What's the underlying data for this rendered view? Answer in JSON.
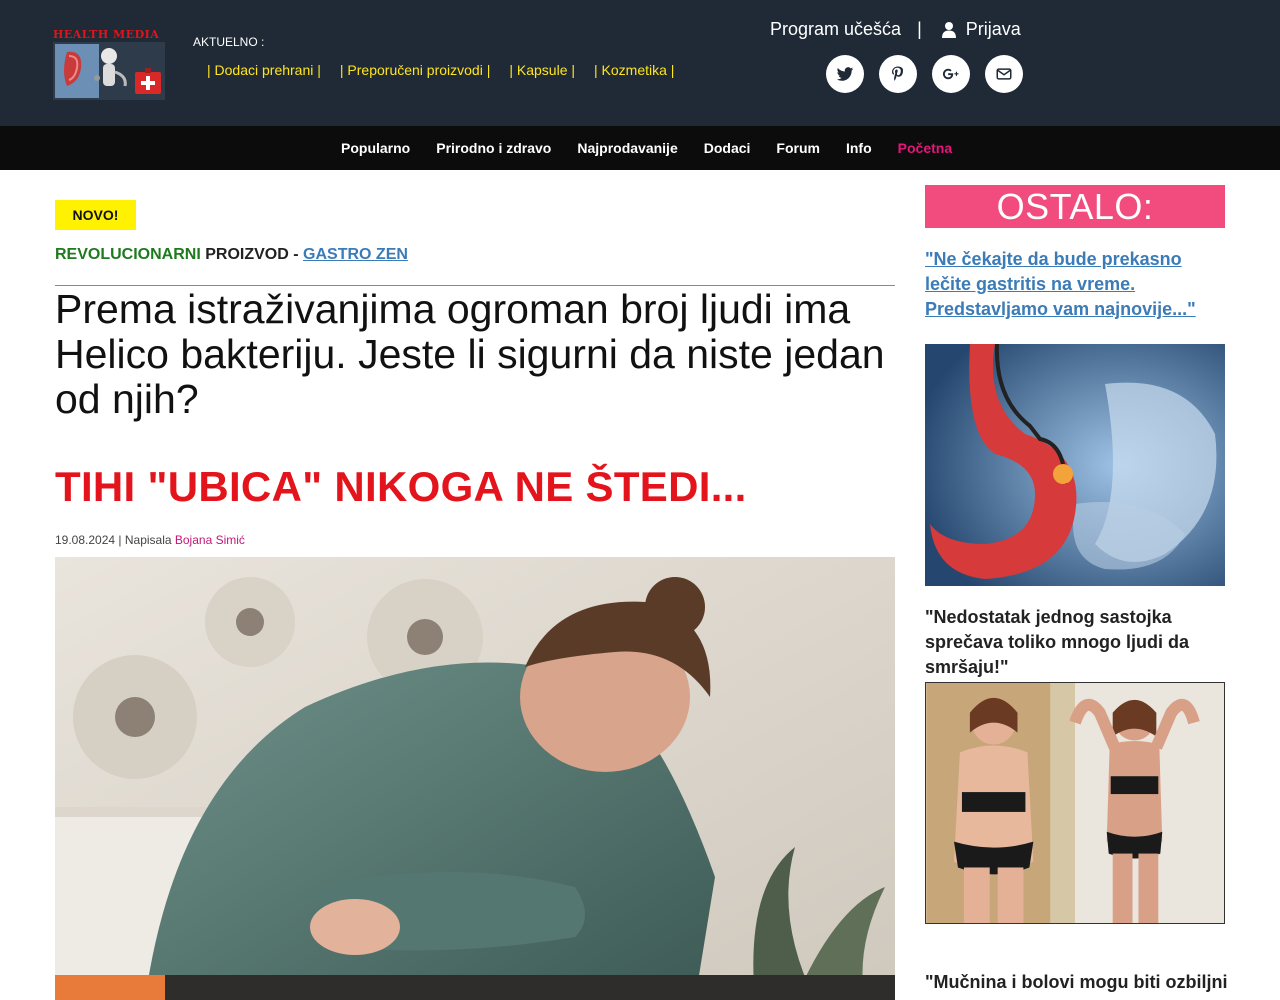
{
  "header": {
    "logo_text": "HEALTH MEDIA",
    "aktuelno_label": "AKTUELNO :",
    "aktuelno_links": [
      "| Dodaci prehrani |",
      "| Preporučeni proizvodi |",
      "| Kapsule |",
      "| Kozmetika |"
    ],
    "program_label": "Program učešća",
    "separator": "|",
    "login_label": "Prijava",
    "social": [
      "twitter-icon",
      "pinterest-icon",
      "google-plus-icon",
      "email-icon"
    ]
  },
  "nav": {
    "items": [
      "Popularno",
      "Prirodno i zdravo",
      "Najprodavanije",
      "Dodaci",
      "Forum",
      "Info",
      "Početna"
    ],
    "active_index": 6
  },
  "article": {
    "badge": "NOVO!",
    "kicker_green": "REVOLUCIONARNI",
    "kicker_dark": "PROIZVOD -",
    "kicker_link": "GASTRO ZEN",
    "headline": "Prema istraživanjima ogroman broj ljudi ima Helico bakteriju. Jeste li sigurni da niste jedan od njih?",
    "subhead": "TIHI \"UBICA\" NIKOGA NE ŠTEDI...",
    "date": "19.08.2024",
    "byline_sep": " | Napisala ",
    "author": "Bojana Simić"
  },
  "sidebar": {
    "title": "OSTALO:",
    "link1": "\"Ne čekajte da bude prekasno lečite gastritis na vreme. Predstavljamo vam najnovije...\"",
    "quote2": "\"Nedostatak jednog sastojka sprečava toliko mnogo ljudi da smršaju!\"",
    "quote3": "\"Mučnina i bolovi mogu biti ozbiljni"
  },
  "colors": {
    "header_bg": "#1f2a36",
    "nav_bg": "#0c0c0c",
    "accent_yellow": "#ffe51c",
    "accent_pink": "#e6157c",
    "headline_red": "#e3141b",
    "sidebar_pink": "#f24b7d",
    "link_blue": "#3b7bb7"
  }
}
